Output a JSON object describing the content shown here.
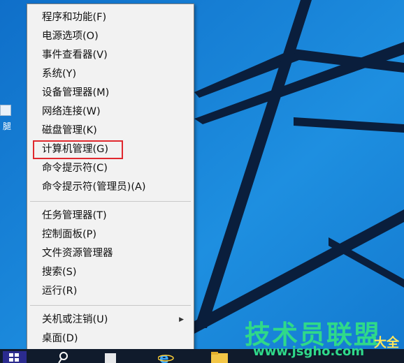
{
  "menu": {
    "items": [
      {
        "label": "程序和功能(F)"
      },
      {
        "label": "电源选项(O)"
      },
      {
        "label": "事件查看器(V)"
      },
      {
        "label": "系统(Y)"
      },
      {
        "label": "设备管理器(M)"
      },
      {
        "label": "网络连接(W)"
      },
      {
        "label": "磁盘管理(K)"
      },
      {
        "label": "计算机管理(G)"
      },
      {
        "label": "命令提示符(C)"
      },
      {
        "label": "命令提示符(管理员)(A)"
      },
      {
        "label": "任务管理器(T)"
      },
      {
        "label": "控制面板(P)"
      },
      {
        "label": "文件资源管理器"
      },
      {
        "label": "搜索(S)"
      },
      {
        "label": "运行(R)"
      },
      {
        "label": "关机或注销(U)"
      },
      {
        "label": "桌面(D)"
      }
    ],
    "highlight_color": "#e0282e"
  },
  "desktop": {
    "icon_label": "腿",
    "background_color": "#1e88dc"
  },
  "watermark": {
    "title": "技术员联盟",
    "url": "www.jsgho.com",
    "tag": "大全"
  },
  "icons": {
    "start": "windows-start-icon",
    "search": "search-icon",
    "ie": "internet-explorer-icon",
    "explorer": "file-explorer-icon"
  }
}
